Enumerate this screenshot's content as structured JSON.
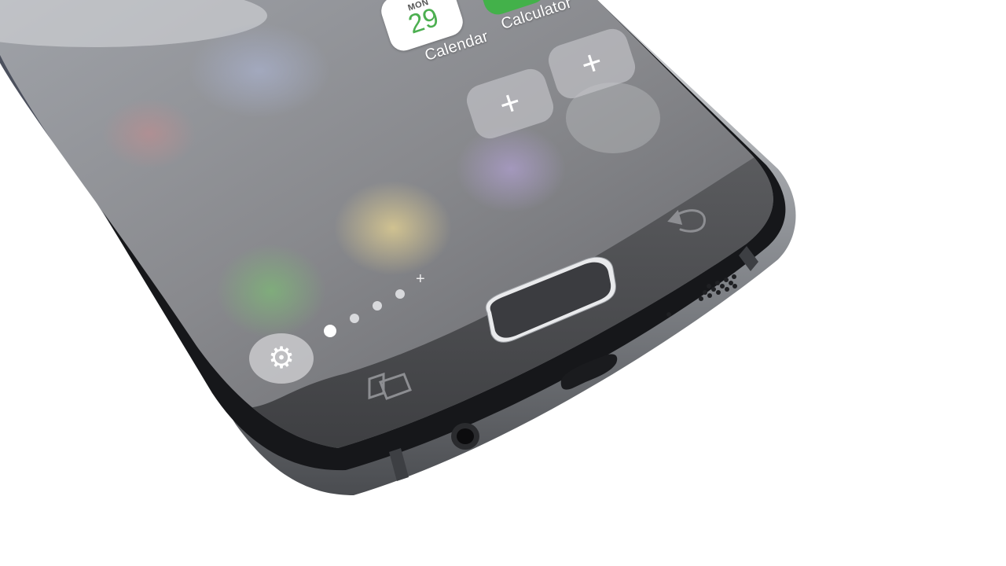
{
  "home_screen": {
    "apps": [
      {
        "name": "Calendar",
        "icon": "calendar-icon",
        "day": "MON",
        "date": "29"
      },
      {
        "name": "Calculator",
        "icon": "calculator-icon"
      }
    ],
    "add_buttons": [
      "plus-icon",
      "plus-icon"
    ],
    "page_indicator": {
      "pages": 4,
      "active_page": 1,
      "add_page_symbol": "+"
    },
    "settings_icon": "gear-icon"
  },
  "nav_bar": {
    "recents_icon": "recent-apps-icon",
    "home_button": "home-button",
    "back_icon": "back-icon"
  },
  "colors": {
    "calendar_date": "#4caf50",
    "calculator": "#43b14a",
    "phone_frame": "#2a2c30",
    "screen_glass": "#7c7d80"
  }
}
